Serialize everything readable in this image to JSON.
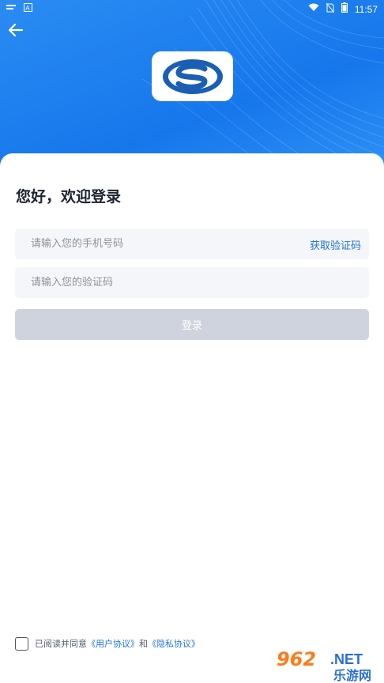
{
  "status_bar": {
    "time": "11:57",
    "left_icons": [
      "notification-icon",
      "a-letter-icon"
    ],
    "right_icons": [
      "wifi-icon",
      "no-sim-icon",
      "battery-icon"
    ]
  },
  "header": {
    "back_icon": "arrow-left-icon",
    "logo_icon": "s-logo-icon"
  },
  "colors": {
    "hero_blue": "#1677ec",
    "link_blue": "#1f73d6",
    "button_disabled": "#cfd3dd",
    "field_bg": "#f5f6f9",
    "title": "#1d2430"
  },
  "login": {
    "greeting": "您好，欢迎登录",
    "phone_placeholder": "请输入您的手机号码",
    "get_code_label": "获取验证码",
    "code_placeholder": "请输入您的验证码",
    "submit_label": "登录"
  },
  "agreement": {
    "prefix": "已阅读并同意",
    "user_agreement": "《用户协议》",
    "joiner": "和",
    "privacy_agreement": "《隐私协议》",
    "checked": false
  },
  "watermark": {
    "number": "962",
    "suffix": ".NET",
    "site_name": "乐游网"
  }
}
